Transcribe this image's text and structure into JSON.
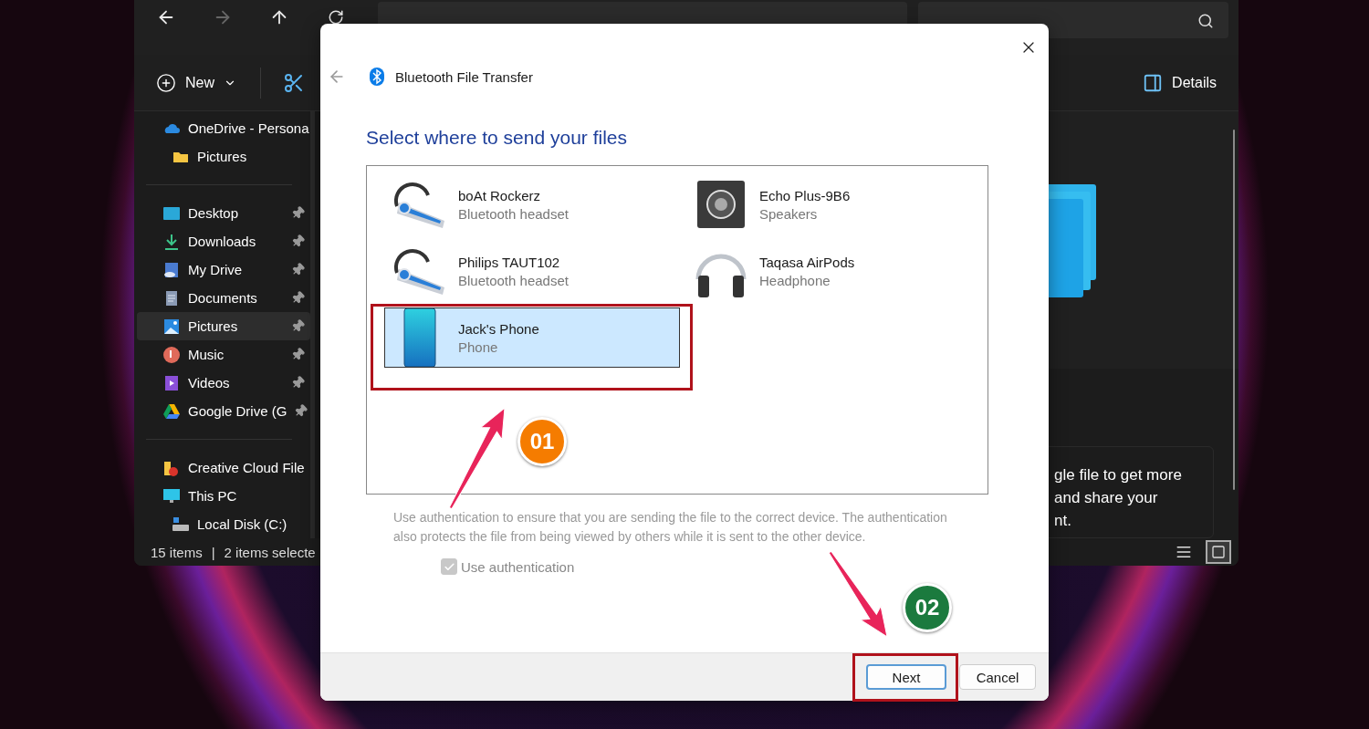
{
  "explorer": {
    "nav": [
      {
        "kind": "back",
        "disabled": false
      },
      {
        "kind": "forward",
        "disabled": true
      },
      {
        "kind": "up",
        "disabled": false
      },
      {
        "kind": "refresh",
        "disabled": false
      }
    ],
    "new_button": "New",
    "details_button": "Details",
    "sidebar": [
      [
        {
          "label": "OneDrive - Persona",
          "kind": "cloud",
          "pinned": false,
          "selected": false,
          "children": [
            {
              "label": "Pictures",
              "kind": "folder",
              "pinned": false,
              "selected": false
            }
          ]
        }
      ],
      [
        {
          "label": "Desktop",
          "kind": "desktop",
          "pinned": true,
          "selected": false
        },
        {
          "label": "Downloads",
          "kind": "download",
          "pinned": true,
          "selected": false
        },
        {
          "label": "My Drive",
          "kind": "drive",
          "pinned": true,
          "selected": false
        },
        {
          "label": "Documents",
          "kind": "documents",
          "pinned": true,
          "selected": false
        },
        {
          "label": "Pictures",
          "kind": "pictures",
          "pinned": true,
          "selected": true
        },
        {
          "label": "Music",
          "kind": "music",
          "pinned": true,
          "selected": false
        },
        {
          "label": "Videos",
          "kind": "videos",
          "pinned": true,
          "selected": false
        },
        {
          "label": "Google Drive (G",
          "kind": "gdrive",
          "pinned": true,
          "selected": false
        }
      ],
      [
        {
          "label": "Creative Cloud File",
          "kind": "creative",
          "pinned": false,
          "selected": false
        },
        {
          "label": "This PC",
          "kind": "pc",
          "pinned": false,
          "selected": false,
          "children": [
            {
              "label": "Local Disk (C:)",
              "kind": "disk",
              "pinned": false,
              "selected": false
            }
          ]
        }
      ]
    ],
    "info_lines": [
      "gle file to get more",
      "and share your",
      "nt."
    ],
    "status": {
      "count": "15 items",
      "separator": "|",
      "selection": "2 items selecte"
    },
    "views": [
      {
        "kind": "details",
        "selected": false
      },
      {
        "kind": "tiles",
        "selected": true
      }
    ]
  },
  "dialog": {
    "title": "Bluetooth File Transfer",
    "heading": "Select where to send your files",
    "devices": [
      {
        "name": "boAt Rockerz",
        "type": "Bluetooth headset",
        "kind": "headset",
        "selected": false
      },
      {
        "name": "Echo Plus-9B6",
        "type": "Speakers",
        "kind": "speaker",
        "selected": false
      },
      {
        "name": "Philips TAUT102",
        "type": "Bluetooth headset",
        "kind": "headset",
        "selected": false
      },
      {
        "name": "Taqasa AirPods",
        "type": "Headphone",
        "kind": "headphone",
        "selected": false
      },
      {
        "name": "Jack's Phone",
        "type": "Phone",
        "kind": "phone",
        "selected": true
      }
    ],
    "description": "Use authentication to ensure that you are sending the file to the correct device. The authentication also protects the file from being viewed by others while it is sent to the other device.",
    "authentication": {
      "label": "Use authentication",
      "checked": true,
      "disabled": true
    },
    "buttons": [
      {
        "label": "Next",
        "default": true
      },
      {
        "label": "Cancel",
        "default": false
      }
    ]
  },
  "annotations": [
    {
      "label": "01",
      "color": "#f57c00",
      "kind": "device"
    },
    {
      "label": "02",
      "color": "#1b7a3e",
      "kind": "button"
    }
  ]
}
